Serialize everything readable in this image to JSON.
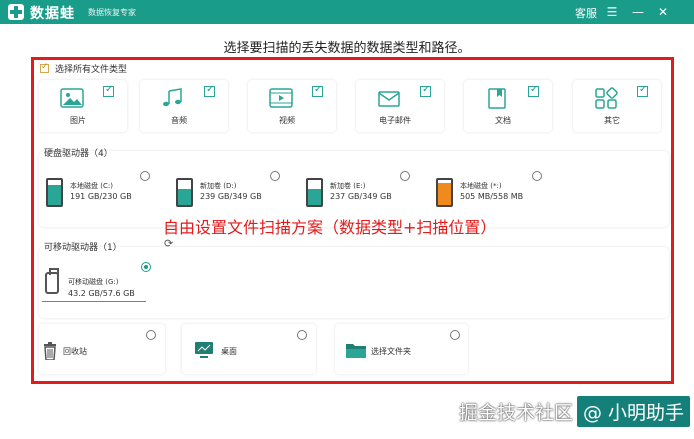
{
  "app": {
    "brand": "数据蛙",
    "subtitle": "数据恢复专家",
    "service_label": "客服",
    "menu_icon": "menu-icon",
    "minimize_icon": "minimize-icon",
    "close_icon": "close-icon"
  },
  "instruction": "选择要扫描的丢失数据的数据类型和路径。",
  "select_all_label": "选择所有文件类型",
  "file_types": [
    {
      "label": "图片",
      "icon": "image-icon",
      "checked": true
    },
    {
      "label": "音频",
      "icon": "music-icon",
      "checked": true
    },
    {
      "label": "视频",
      "icon": "video-icon",
      "checked": true
    },
    {
      "label": "电子邮件",
      "icon": "email-icon",
      "checked": true
    },
    {
      "label": "文档",
      "icon": "document-icon",
      "checked": true
    },
    {
      "label": "其它",
      "icon": "other-icon",
      "checked": true
    }
  ],
  "hard_drives": {
    "title": "硬盘驱动器（4）",
    "items": [
      {
        "name": "本地磁盘 (C:)",
        "size": "191 GB/230 GB",
        "used": 0.83,
        "color": "#2aa596"
      },
      {
        "name": "新加卷 (D:)",
        "size": "239 GB/349 GB",
        "used": 0.68,
        "color": "#2aa596"
      },
      {
        "name": "新加卷 (E:)",
        "size": "237 GB/349 GB",
        "used": 0.68,
        "color": "#2aa596"
      },
      {
        "name": "本地磁盘 (*:)",
        "size": "505 MB/558 MB",
        "used": 0.9,
        "color": "#f08a1c"
      }
    ]
  },
  "removable": {
    "title": "可移动驱动器（1）",
    "refresh_icon": "refresh-icon",
    "items": [
      {
        "name": "可移动磁盘 (G:)",
        "size": "43.2 GB/57.6 GB",
        "selected": true
      }
    ]
  },
  "locations": [
    {
      "label": "回收站",
      "icon": "recycle-bin-icon"
    },
    {
      "label": "桌面",
      "icon": "desktop-icon"
    },
    {
      "label": "选择文件夹",
      "icon": "folder-icon"
    }
  ],
  "annotation": "自由设置文件扫描方案（数据类型+扫描位置）",
  "watermark": {
    "main": "掘金技术社区",
    "tag": "@ 小明助手"
  },
  "colors": {
    "brand": "#1a9c8a",
    "annotation_red": "#e21b1b",
    "drive_orange": "#f08a1c"
  }
}
